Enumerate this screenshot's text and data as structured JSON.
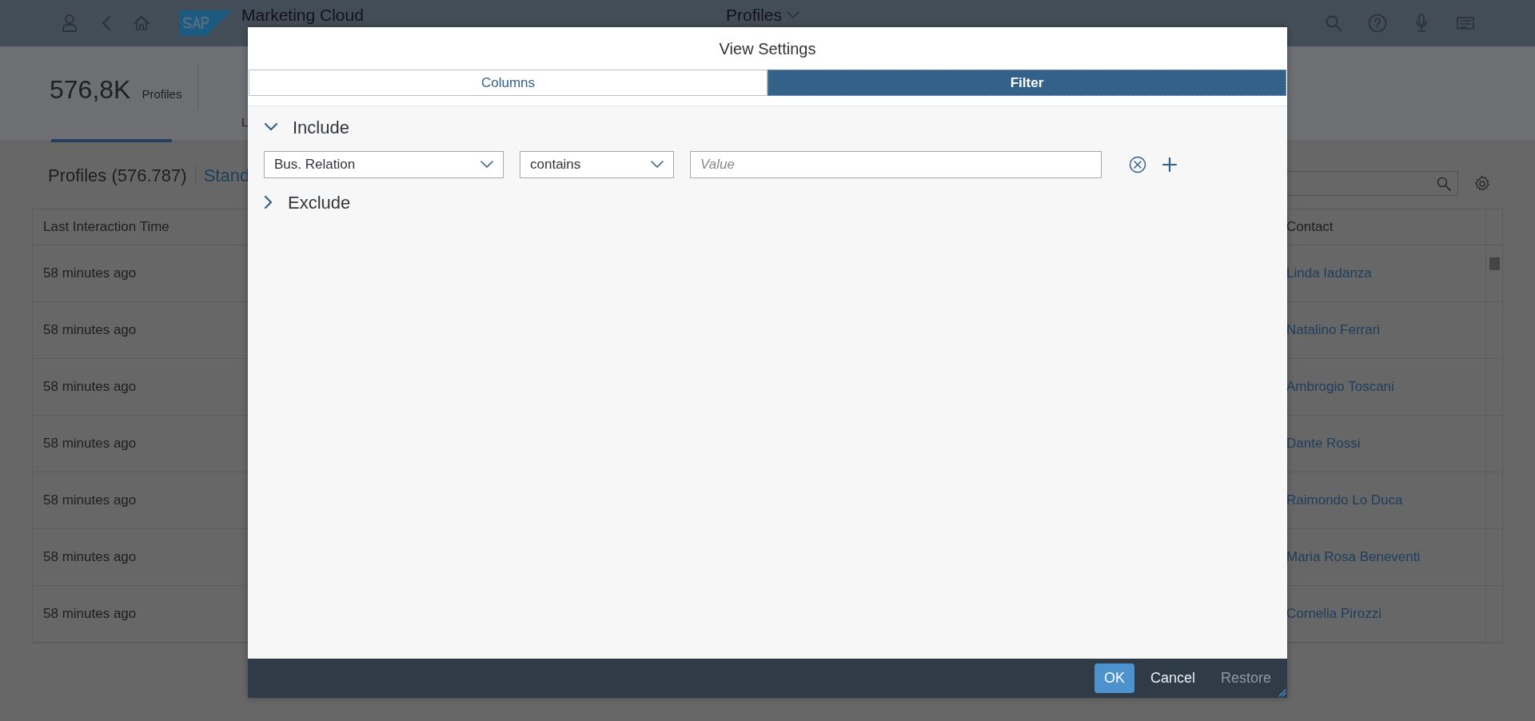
{
  "shell": {
    "app_title": "Marketing Cloud",
    "page_title": "Profiles"
  },
  "header": {
    "kpi_value": "576,8K",
    "kpi_label": "Profiles",
    "next_tab_partial": "L"
  },
  "table_toolbar": {
    "title": "Profiles (576.787)",
    "variant_partial": "Stand"
  },
  "table": {
    "columns": [
      "Last Interaction Time",
      "Contact"
    ],
    "rows": [
      {
        "last_interaction": "58 minutes ago",
        "contact": "Linda Iadanza"
      },
      {
        "last_interaction": "58 minutes ago",
        "contact": "Natalino Ferrari"
      },
      {
        "last_interaction": "58 minutes ago",
        "contact": "Ambrogio Toscani"
      },
      {
        "last_interaction": "58 minutes ago",
        "contact": "Dante Rossi"
      },
      {
        "last_interaction": "58 minutes ago",
        "contact": "Raimondo Lo Duca"
      },
      {
        "last_interaction": "58 minutes ago",
        "contact": "Maria Rosa Beneventi"
      },
      {
        "last_interaction": "58 minutes ago",
        "contact": "Cornelia Pirozzi"
      }
    ]
  },
  "dialog": {
    "title": "View Settings",
    "tabs": [
      {
        "label": "Columns",
        "selected": false
      },
      {
        "label": "Filter",
        "selected": true
      }
    ],
    "sections": [
      {
        "label": "Include",
        "expanded": true,
        "conditions": [
          {
            "field": "Bus. Relation",
            "operator": "contains",
            "placeholder": "Value"
          }
        ]
      },
      {
        "label": "Exclude",
        "expanded": false
      }
    ],
    "buttons": [
      {
        "label": "OK",
        "kind": "emphasized",
        "disabled": false
      },
      {
        "label": "Cancel",
        "kind": "transparent",
        "disabled": false
      },
      {
        "label": "Restore",
        "kind": "transparent",
        "disabled": true
      }
    ]
  }
}
